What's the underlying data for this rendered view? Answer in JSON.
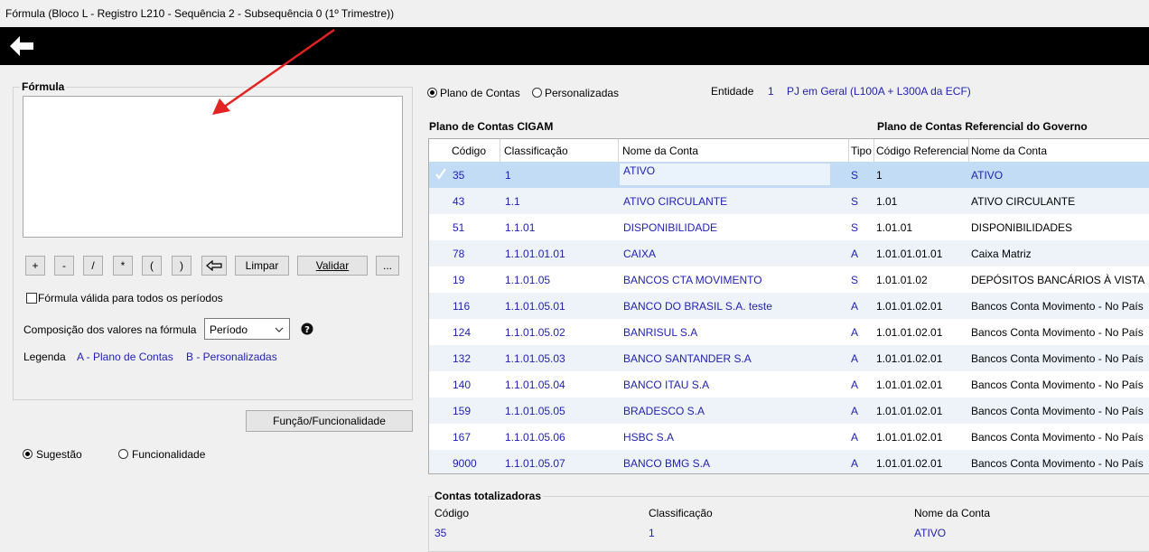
{
  "window": {
    "title": "Fórmula (Bloco L - Registro L210 - Sequência 2 - Subsequência 0 (1º Trimestre))"
  },
  "toolbar": {
    "back_icon": "arrow-left-icon"
  },
  "formula": {
    "group_title": "Fórmula",
    "text": "",
    "buttons": [
      "+",
      "-",
      "/",
      "*",
      "(",
      ")"
    ],
    "backspace_icon": "backspace-arrow-icon",
    "clear_label": "Limpar",
    "validate_label": "Validar",
    "more_label": "...",
    "valid_all_periods_label": "Fórmula válida para todos os períodos",
    "valid_all_periods_checked": false,
    "composition_label": "Composição dos valores na fórmula",
    "composition_value": "Período",
    "legend_label": "Legenda",
    "legend_a": "A - Plano de Contas",
    "legend_b": "B - Personalizadas"
  },
  "function_button": "Função/Funcionalidade",
  "mode": {
    "suggestion_label": "Sugestão",
    "functionality_label": "Funcionalidade",
    "selected": "Sugestão"
  },
  "source": {
    "plano_label": "Plano de Contas",
    "personalizadas_label": "Personalizadas",
    "selected": "Plano de Contas"
  },
  "entity": {
    "label": "Entidade",
    "code": "1",
    "name": "PJ em Geral (L100A + L300A da ECF)"
  },
  "grid": {
    "title_left": "Plano de Contas CIGAM",
    "title_right": "Plano de Contas Referencial do Governo",
    "columns": [
      "Código",
      "Classificação",
      "Nome da Conta",
      "Tipo",
      "Código Referencial",
      "Nome da Conta"
    ],
    "rows": [
      {
        "codigo": "35",
        "classificacao": "1",
        "nome": "ATIVO",
        "tipo": "S",
        "ref": "1",
        "ref_nome": "ATIVO"
      },
      {
        "codigo": "43",
        "classificacao": "1.1",
        "nome": "ATIVO CIRCULANTE",
        "tipo": "S",
        "ref": "1.01",
        "ref_nome": "ATIVO CIRCULANTE"
      },
      {
        "codigo": "51",
        "classificacao": "1.1.01",
        "nome": "DISPONIBILIDADE",
        "tipo": "S",
        "ref": "1.01.01",
        "ref_nome": "DISPONIBILIDADES"
      },
      {
        "codigo": "78",
        "classificacao": "1.1.01.01.01",
        "nome": "CAIXA",
        "tipo": "A",
        "ref": "1.01.01.01.01",
        "ref_nome": "Caixa Matriz"
      },
      {
        "codigo": "19",
        "classificacao": "1.1.01.05",
        "nome": "BANCOS CTA MOVIMENTO",
        "tipo": "S",
        "ref": "1.01.01.02",
        "ref_nome": "DEPÓSITOS BANCÁRIOS À VISTA"
      },
      {
        "codigo": "116",
        "classificacao": "1.1.01.05.01",
        "nome": "BANCO DO BRASIL S.A. teste",
        "tipo": "A",
        "ref": "1.01.01.02.01",
        "ref_nome": "Bancos Conta Movimento - No País"
      },
      {
        "codigo": "124",
        "classificacao": "1.1.01.05.02",
        "nome": "BANRISUL S.A",
        "tipo": "A",
        "ref": "1.01.01.02.01",
        "ref_nome": "Bancos Conta Movimento - No País"
      },
      {
        "codigo": "132",
        "classificacao": "1.1.01.05.03",
        "nome": "BANCO SANTANDER S.A",
        "tipo": "A",
        "ref": "1.01.01.02.01",
        "ref_nome": "Bancos Conta Movimento - No País"
      },
      {
        "codigo": "140",
        "classificacao": "1.1.01.05.04",
        "nome": "BANCO ITAU S.A",
        "tipo": "A",
        "ref": "1.01.01.02.01",
        "ref_nome": "Bancos Conta Movimento - No País"
      },
      {
        "codigo": "159",
        "classificacao": "1.1.01.05.05",
        "nome": "BRADESCO S.A",
        "tipo": "A",
        "ref": "1.01.01.02.01",
        "ref_nome": "Bancos Conta Movimento - No País"
      },
      {
        "codigo": "167",
        "classificacao": "1.1.01.05.06",
        "nome": "HSBC S.A",
        "tipo": "A",
        "ref": "1.01.01.02.01",
        "ref_nome": "Bancos Conta Movimento - No País"
      },
      {
        "codigo": "9000",
        "classificacao": "1.1.01.05.07",
        "nome": "BANCO BMG S.A",
        "tipo": "A",
        "ref": "1.01.01.02.01",
        "ref_nome": "Bancos Conta Movimento - No País"
      }
    ]
  },
  "totals": {
    "title": "Contas totalizadoras",
    "col_codigo": "Código",
    "col_classificacao": "Classificação",
    "col_nome": "Nome da Conta",
    "codigo": "35",
    "classificacao": "1",
    "nome": "ATIVO"
  },
  "annotation": {
    "arrow_color": "#e32222"
  }
}
